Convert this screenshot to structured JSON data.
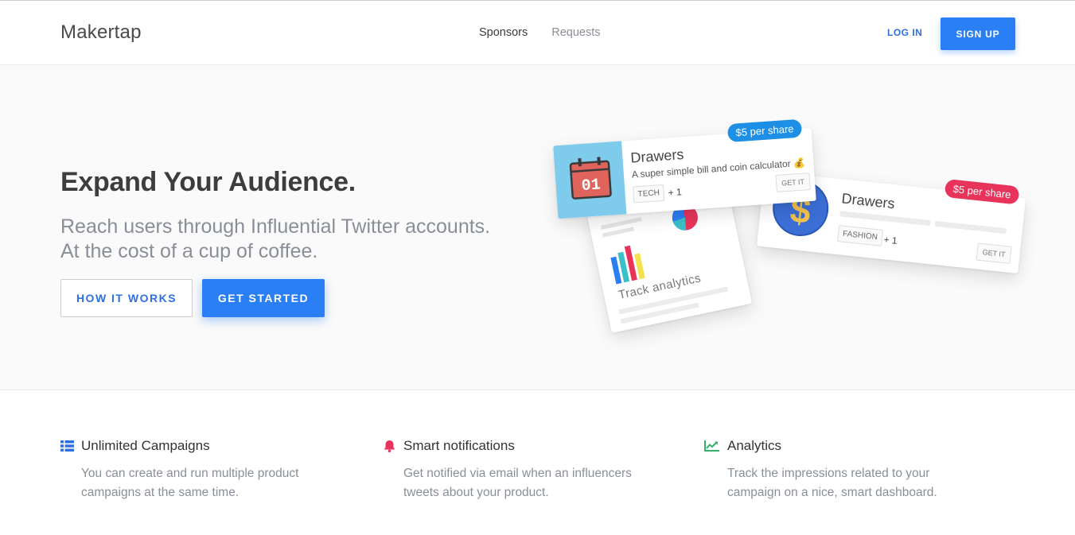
{
  "header": {
    "brand": "Makertap",
    "nav": [
      {
        "label": "Sponsors"
      },
      {
        "label": "Requests"
      }
    ],
    "login_label": "LOG IN",
    "signup_label": "SIGN UP"
  },
  "hero": {
    "title": "Expand Your Audience.",
    "subtitle_line1": "Reach users through Influential Twitter accounts.",
    "subtitle_line2": "At the cost of a cup of coffee.",
    "how_label": "HOW IT WORKS",
    "start_label": "GET STARTED"
  },
  "illustration": {
    "card1": {
      "calendar_day": "01",
      "title": "Drawers",
      "description": "A super simple bill and coin calculator 💰",
      "tag": "TECH",
      "plus": "+ 1",
      "action": "GET IT",
      "price": "$5 per share"
    },
    "card2": {
      "title": "Drawers",
      "tag": "FASHION",
      "plus": "+ 1",
      "action": "GET IT",
      "price": "$5 per share"
    },
    "analytics_card": {
      "label": "Track analytics"
    },
    "colors": {
      "price_blue": "#1e8fe6",
      "price_red": "#e8345a",
      "calendar_bg": "#7ecbeb",
      "calendar_red": "#e0645c",
      "coin_blue": "#3b6fd6",
      "coin_gold": "#f3c14d"
    }
  },
  "features": [
    {
      "icon": "list-icon",
      "title": "Unlimited Campaigns",
      "desc": "You can create and run multiple product campaigns at the same time.",
      "color": "#2f6fe4"
    },
    {
      "icon": "bell-icon",
      "title": "Smart notifications",
      "desc": "Get notified via email when an influencers tweets about your product.",
      "color": "#e8345a"
    },
    {
      "icon": "line-chart-icon",
      "title": "Analytics",
      "desc": "Track the impressions related to your campaign on a nice, smart dashboard.",
      "color": "#2fb36b"
    }
  ]
}
